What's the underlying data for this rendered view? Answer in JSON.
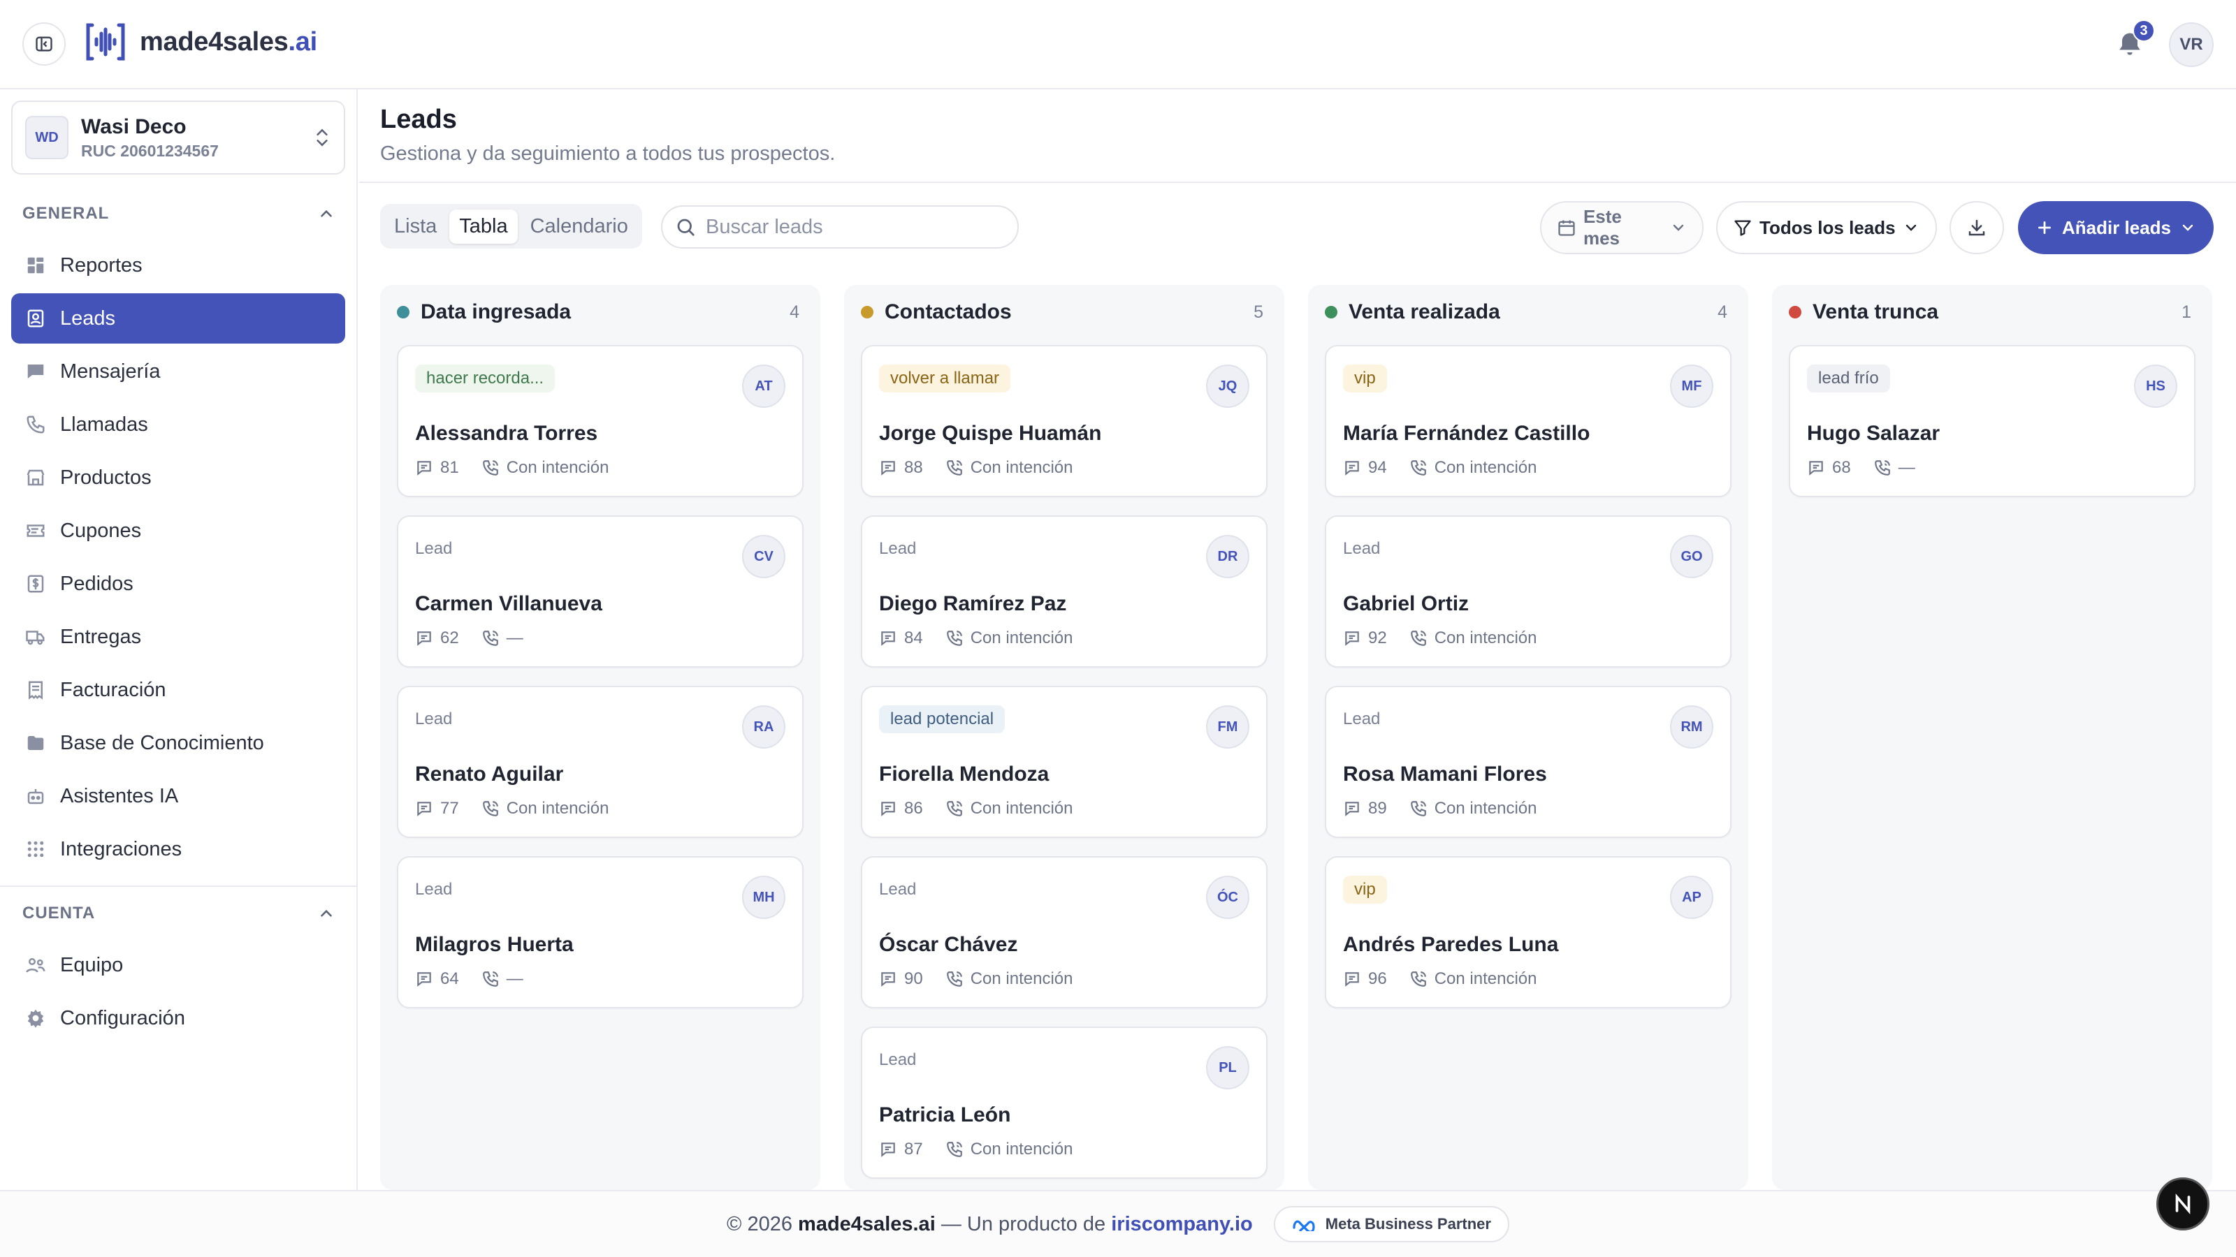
{
  "app": {
    "logo_main": "made4sales",
    "logo_accent": ".ai",
    "notifications_count": "3",
    "user_initials": "VR"
  },
  "org": {
    "initials": "WD",
    "name": "Wasi Deco",
    "ruc": "RUC 20601234567"
  },
  "sidebar": {
    "general_label": "GENERAL",
    "account_label": "CUENTA",
    "general_items": [
      {
        "label": "Reportes",
        "icon": "chart-icon"
      },
      {
        "label": "Leads",
        "icon": "contact-icon",
        "active": true
      },
      {
        "label": "Mensajería",
        "icon": "chat-icon"
      },
      {
        "label": "Llamadas",
        "icon": "phone-icon"
      },
      {
        "label": "Productos",
        "icon": "store-icon"
      },
      {
        "label": "Cupones",
        "icon": "ticket-icon"
      },
      {
        "label": "Pedidos",
        "icon": "dollar-icon"
      },
      {
        "label": "Entregas",
        "icon": "truck-icon"
      },
      {
        "label": "Facturación",
        "icon": "receipt-icon"
      },
      {
        "label": "Base de Conocimiento",
        "icon": "folder-icon"
      },
      {
        "label": "Asistentes IA",
        "icon": "bot-icon"
      },
      {
        "label": "Integraciones",
        "icon": "grid-icon"
      }
    ],
    "account_items": [
      {
        "label": "Equipo",
        "icon": "team-icon"
      },
      {
        "label": "Configuración",
        "icon": "gear-icon"
      }
    ]
  },
  "page": {
    "title": "Leads",
    "subtitle": "Gestiona y da seguimiento a todos tus prospectos."
  },
  "toolbar": {
    "views": [
      "Lista",
      "Tabla",
      "Calendario"
    ],
    "active_view": "Tabla",
    "search_placeholder": "Buscar leads",
    "period_label": "Este mes",
    "filter_label": "Todos los leads",
    "add_label": "Añadir leads"
  },
  "colors": {
    "accent": "#4453b7",
    "data_ingresada": "#3f8f9a",
    "contactados": "#c89a2c",
    "venta_realizada": "#3d8f5c",
    "venta_trunca": "#d04a3f"
  },
  "board": {
    "columns": [
      {
        "title": "Data ingresada",
        "count": "4",
        "color": "#3f8f9a",
        "cards": [
          {
            "tag": "hacer recorda...",
            "tag_style": "green",
            "initials": "AT",
            "name": "Alessandra Torres",
            "score": "81",
            "intent": "Con intención"
          },
          {
            "tag": "Lead",
            "tag_style": "plain",
            "initials": "CV",
            "name": "Carmen Villanueva",
            "score": "62",
            "intent": "—"
          },
          {
            "tag": "Lead",
            "tag_style": "plain",
            "initials": "RA",
            "name": "Renato Aguilar",
            "score": "77",
            "intent": "Con intención"
          },
          {
            "tag": "Lead",
            "tag_style": "plain",
            "initials": "MH",
            "name": "Milagros Huerta",
            "score": "64",
            "intent": "—"
          }
        ]
      },
      {
        "title": "Contactados",
        "count": "5",
        "color": "#c89a2c",
        "cards": [
          {
            "tag": "volver a llamar",
            "tag_style": "amber",
            "initials": "JQ",
            "name": "Jorge Quispe Huamán",
            "score": "88",
            "intent": "Con intención"
          },
          {
            "tag": "Lead",
            "tag_style": "plain",
            "initials": "DR",
            "name": "Diego Ramírez Paz",
            "score": "84",
            "intent": "Con intención"
          },
          {
            "tag": "lead potencial",
            "tag_style": "blue",
            "initials": "FM",
            "name": "Fiorella Mendoza",
            "score": "86",
            "intent": "Con intención"
          },
          {
            "tag": "Lead",
            "tag_style": "plain",
            "initials": "ÓC",
            "name": "Óscar Chávez",
            "score": "90",
            "intent": "Con intención"
          },
          {
            "tag": "Lead",
            "tag_style": "plain",
            "initials": "PL",
            "name": "Patricia León",
            "score": "87",
            "intent": "Con intención"
          }
        ]
      },
      {
        "title": "Venta realizada",
        "count": "4",
        "color": "#3d8f5c",
        "cards": [
          {
            "tag": "vip",
            "tag_style": "amber",
            "initials": "MF",
            "name": "María Fernández Castillo",
            "score": "94",
            "intent": "Con intención"
          },
          {
            "tag": "Lead",
            "tag_style": "plain",
            "initials": "GO",
            "name": "Gabriel Ortiz",
            "score": "92",
            "intent": "Con intención"
          },
          {
            "tag": "Lead",
            "tag_style": "plain",
            "initials": "RM",
            "name": "Rosa Mamani Flores",
            "score": "89",
            "intent": "Con intención"
          },
          {
            "tag": "vip",
            "tag_style": "amber",
            "initials": "AP",
            "name": "Andrés Paredes Luna",
            "score": "96",
            "intent": "Con intención"
          }
        ]
      },
      {
        "title": "Venta trunca",
        "count": "1",
        "color": "#d04a3f",
        "cards": [
          {
            "tag": "lead frío",
            "tag_style": "grey",
            "initials": "HS",
            "name": "Hugo Salazar",
            "score": "68",
            "intent": "—"
          }
        ]
      }
    ]
  },
  "footer": {
    "copyright": "© 2026",
    "brand": "made4sales.ai",
    "product_text": "— Un producto de",
    "company": "iriscompany.io",
    "partner_label": "Meta Business Partner"
  }
}
